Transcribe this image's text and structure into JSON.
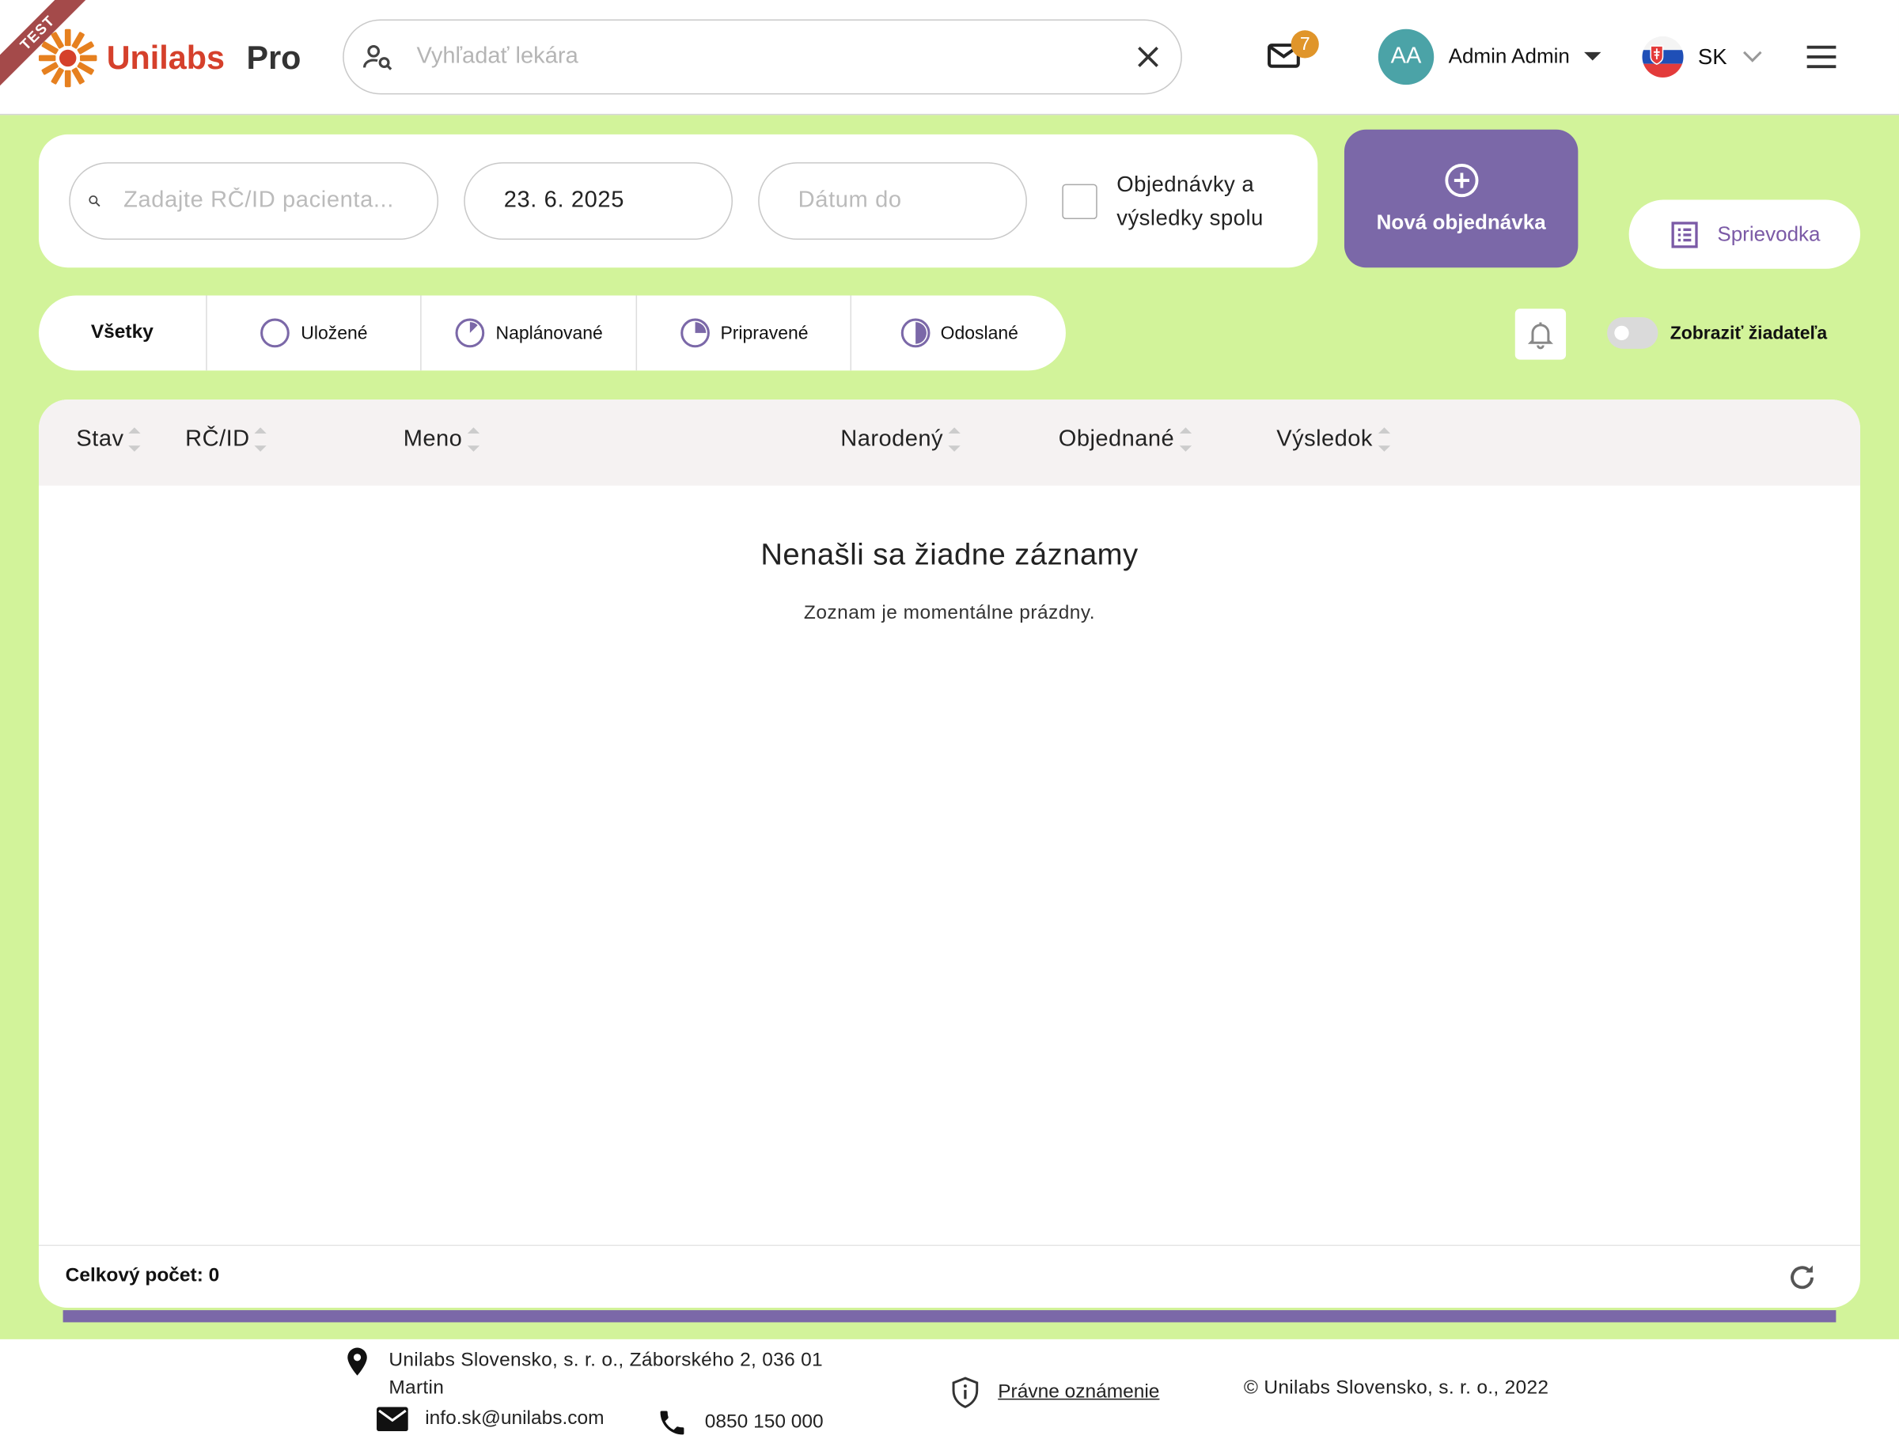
{
  "header": {
    "ribbon": "TEST",
    "logo_text": "Unilabs",
    "logo_pro": "Pro",
    "doctor_search_placeholder": "Vyhľadať lekára",
    "mail_badge": "7",
    "avatar_initials": "AA",
    "user_name": "Admin Admin",
    "language": "SK"
  },
  "filters": {
    "patient_placeholder": "Zadajte RČ/ID pacienta...",
    "date_from": "23. 6. 2025",
    "date_to_placeholder": "Dátum do",
    "combined_checkbox_label_1": "Objednávky a",
    "combined_checkbox_label_2": "výsledky spolu",
    "combined_checked": false
  },
  "actions": {
    "new_order": "Nová objednávka",
    "guide": "Sprievodka"
  },
  "tabs": [
    {
      "label": "Všetky",
      "active": true
    },
    {
      "label": "Uložené"
    },
    {
      "label": "Naplánované"
    },
    {
      "label": "Pripravené"
    },
    {
      "label": "Odoslané"
    }
  ],
  "show_requester": {
    "label": "Zobraziť žiadateľa",
    "on": false
  },
  "table": {
    "columns": [
      "Stav",
      "RČ/ID",
      "Meno",
      "Narodený",
      "Objednané",
      "Výsledok"
    ],
    "empty_title": "Nenašli sa žiadne záznamy",
    "empty_subtitle": "Zoznam je momentálne prázdny.",
    "total_label": "Celkový počet: 0"
  },
  "footer": {
    "address_line1": "Unilabs Slovensko, s. r. o., Záborského 2, 036 01",
    "address_line2": "Martin",
    "email": "info.sk@unilabs.com",
    "phone": "0850 150 000",
    "legal": "Právne oznámenie",
    "copyright": "© Unilabs Slovensko, s. r. o., 2022"
  },
  "colors": {
    "background": "#d2f39a",
    "accent": "#7b68a8",
    "brand_red": "#d5402b",
    "avatar": "#4ba3a7",
    "badge": "#e0952a"
  }
}
